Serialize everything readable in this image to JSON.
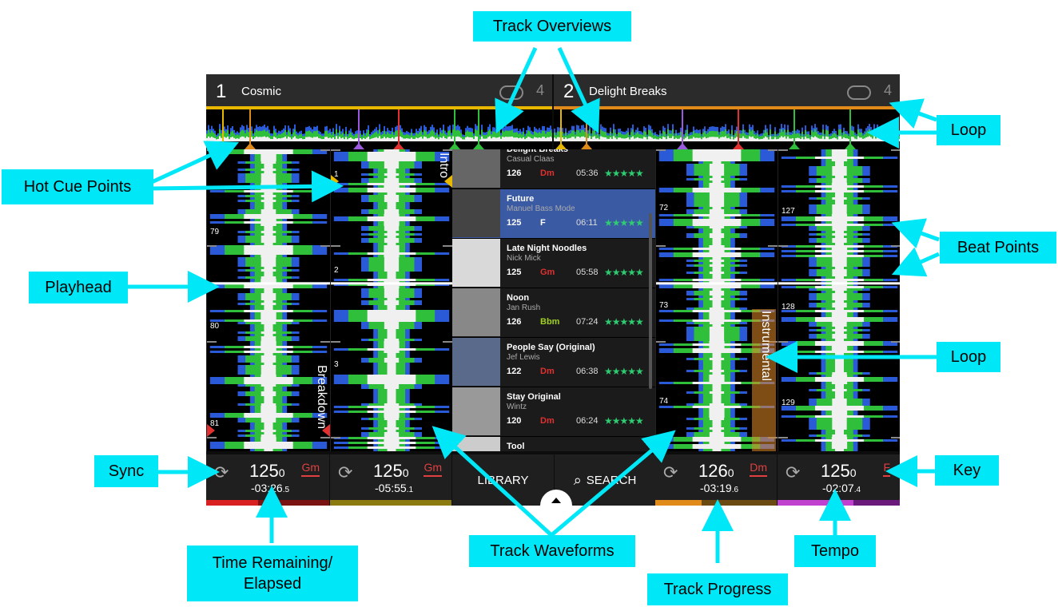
{
  "deck1": {
    "number": "1",
    "title": "Cosmic",
    "loop_count": "4",
    "bpm": "125",
    "bpm_decimal": "0",
    "key": "Gm",
    "time": "-03:26",
    "time_decimal": ".5",
    "color": "#e8b800"
  },
  "deck2": {
    "number": "2",
    "title": "Delight Breaks",
    "loop_count": "4",
    "bpm": "126",
    "bpm_decimal": "0",
    "key": "Dm",
    "time": "-03:19",
    "time_decimal": ".6",
    "color": "#e08a1a"
  },
  "deck3": {
    "bpm": "125",
    "bpm_decimal": "0",
    "key": "Gm",
    "time": "-05:55",
    "time_decimal": ".1"
  },
  "deck4": {
    "bpm": "125",
    "bpm_decimal": "0",
    "key": "F",
    "time": "-02:07",
    "time_decimal": ".4"
  },
  "buttons": {
    "library": "LIBRARY",
    "search": "SEARCH"
  },
  "waveform_labels": {
    "breakdown": "Breakdown",
    "intro": "Intro",
    "instrumental": "Instrumental"
  },
  "beat_numbers": {
    "d1": [
      "79",
      "80",
      "81"
    ],
    "d3": [
      "1",
      "2",
      "3"
    ],
    "d2": [
      "72",
      "73",
      "74"
    ],
    "d4": [
      "127",
      "128",
      "129"
    ]
  },
  "library": {
    "tracks": [
      {
        "title": "Delight Breaks",
        "artist": "Casual Claas",
        "bpm": "126",
        "key": "Dm",
        "key_color": "#e03030",
        "length": "05:36",
        "stars": "★★★★★"
      },
      {
        "title": "Future",
        "artist": "Manuel Bass Mode",
        "bpm": "125",
        "key": "F",
        "key_color": "#ffffff",
        "length": "06:11",
        "stars": "★★★★★"
      },
      {
        "title": "Late Night Noodles",
        "artist": "Nick Mick",
        "bpm": "125",
        "key": "Gm",
        "key_color": "#e03030",
        "length": "05:58",
        "stars": "★★★★★"
      },
      {
        "title": "Noon",
        "artist": "Jan Rush",
        "bpm": "126",
        "key": "Bbm",
        "key_color": "#a0d020",
        "length": "07:24",
        "stars": "★★★★★"
      },
      {
        "title": "People Say (Original)",
        "artist": "Jef Lewis",
        "bpm": "122",
        "key": "Dm",
        "key_color": "#e03030",
        "length": "06:38",
        "stars": "★★★★★"
      },
      {
        "title": "Stay Original",
        "artist": "Wintz",
        "bpm": "120",
        "key": "Dm",
        "key_color": "#e03030",
        "length": "06:24",
        "stars": "★★★★★"
      },
      {
        "title": "Tool",
        "artist": "",
        "bpm": "",
        "key": "",
        "key_color": "#ffffff",
        "length": "",
        "stars": ""
      }
    ]
  },
  "callouts": {
    "track_overviews": "Track Overviews",
    "loop_top": "Loop",
    "hot_cue_points": "Hot Cue Points",
    "beat_points": "Beat Points",
    "playhead": "Playhead",
    "loop_mid": "Loop",
    "sync": "Sync",
    "key": "Key",
    "time_remaining_line1": "Time Remaining/",
    "time_remaining_line2": "Elapsed",
    "track_waveforms": "Track Waveforms",
    "tempo": "Tempo",
    "track_progress": "Track Progress"
  },
  "icons": {
    "sync": "sync-icon",
    "loop": "loop-icon",
    "search": "search-icon",
    "chevron": "chevron-up-icon"
  },
  "progress": {
    "deck1": 0.42,
    "deck3": 0.0,
    "deck2": 0.38,
    "deck4": 0.62
  }
}
